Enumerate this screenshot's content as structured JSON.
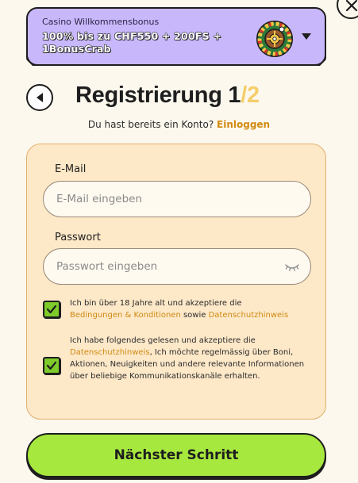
{
  "bonus": {
    "subtitle": "Casino Willkommensbonus",
    "title": "100% bis zu CHF550 + 200FS + 1BonusCrab"
  },
  "header": {
    "title": "Registrierung",
    "step_current": "1",
    "step_total": "/2"
  },
  "login": {
    "prompt": "Du hast bereits ein Konto?",
    "link": "Einloggen"
  },
  "form": {
    "email_label": "E-Mail",
    "email_placeholder": "E-Mail eingeben",
    "email_value": "",
    "password_label": "Passwort",
    "password_placeholder": "Passwort eingeben",
    "password_value": ""
  },
  "consents": [
    {
      "checked": true,
      "text_1": "Ich bin über 18 Jahre alt und akzeptiere die",
      "link_1": "Bedingungen & Konditionen",
      "text_2": "sowie",
      "link_2": "Datenschutzhinweis"
    },
    {
      "checked": true,
      "text_1": "Ich habe folgendes gelesen und akzeptiere die",
      "link_1": "Datenschutzhinweis",
      "text_2": ", Ich möchte regelmässig über Boni, Aktionen, Neuigkeiten und andere relevante Informationen über beliebige Kommunikationskanäle erhalten."
    }
  ],
  "actions": {
    "next_label": "Nächster Schritt"
  },
  "colors": {
    "banner": "#c8b8fb",
    "accent_link": "#d18a12",
    "step_total": "#f4ce6a",
    "card": "#fde8c8",
    "checkbox": "#7ecb2a",
    "primary_button": "#a7e83e"
  },
  "icons": {
    "close": "close-icon",
    "roulette": "roulette-wheel-icon",
    "expand": "chevron-down-icon",
    "back": "chevron-left-icon",
    "password_toggle": "eye-closed-icon",
    "checkbox": "checkmark-icon"
  }
}
